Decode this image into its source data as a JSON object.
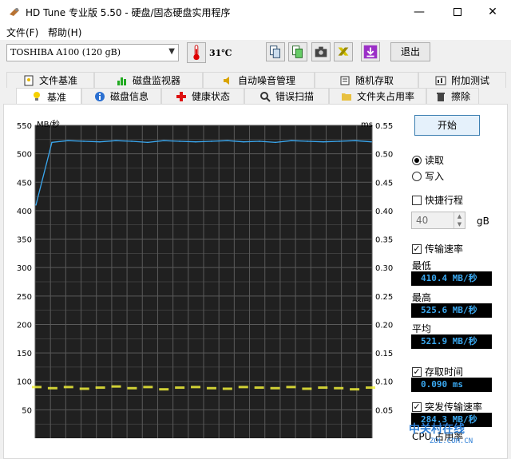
{
  "window": {
    "title": "HD Tune 专业版 5.50 - 硬盘/固态硬盘实用程序"
  },
  "menu": {
    "file": "文件(F)",
    "help": "帮助(H)"
  },
  "toolbar": {
    "drive": "TOSHIBA A100 (120 gB)",
    "temperature": "31℃",
    "exit_label": "退出",
    "icons": [
      "copy-info-icon",
      "copy-text-icon",
      "camera-icon",
      "settings-icon",
      "save-icon"
    ]
  },
  "tabs_top": [
    "文件基准",
    "磁盘监视器",
    "自动噪音管理",
    "随机存取",
    "附加测试"
  ],
  "tabs_bottom": [
    "基准",
    "磁盘信息",
    "健康状态",
    "错误扫描",
    "文件夹占用率",
    "擦除"
  ],
  "side": {
    "start_label": "开始",
    "read_label": "读取",
    "write_label": "写入",
    "quick_label": "快捷行程",
    "quick_value": "40",
    "quick_unit": "gB",
    "transfer_label": "传输速率",
    "min_label": "最低",
    "min_value": "410.4 MB/秒",
    "max_label": "最高",
    "max_value": "525.6 MB/秒",
    "avg_label": "平均",
    "avg_value": "521.9 MB/秒",
    "access_label": "存取时间",
    "access_value": "0.090 ms",
    "burst_label": "突发传输速率",
    "burst_value": "284.3 MB/秒",
    "cpu_label": "CPU 占用率"
  },
  "watermark": {
    "text": "中关村在线",
    "sub": "ZOL.COM.CN"
  },
  "chart_data": {
    "type": "line",
    "left_axis_label": "MB/秒",
    "right_axis_label": "ms",
    "y_ticks": [
      550,
      500,
      450,
      400,
      350,
      300,
      250,
      200,
      150,
      100,
      50
    ],
    "y2_ticks": [
      "0.55",
      "0.50",
      "0.45",
      "0.40",
      "0.35",
      "0.30",
      "0.25",
      "0.20",
      "0.15",
      "0.10",
      "0.05"
    ],
    "ylim": [
      0,
      550
    ],
    "y2lim": [
      0,
      0.55
    ],
    "grid": true,
    "colors": {
      "transfer": "#3aa8f0",
      "access": "#f0f03a",
      "bg": "#202020",
      "grid": "#5a5a5a"
    },
    "series": [
      {
        "values": [
          410,
          520,
          523,
          522,
          521,
          523,
          522,
          520,
          523,
          522,
          521,
          522,
          523,
          521,
          522,
          520,
          523,
          522,
          521,
          522,
          523,
          521
        ]
      },
      {
        "values": [
          0.09,
          0.088,
          0.09,
          0.087,
          0.089,
          0.091,
          0.088,
          0.09,
          0.086,
          0.089,
          0.09,
          0.088,
          0.087,
          0.09,
          0.089,
          0.088,
          0.09,
          0.087,
          0.089,
          0.088,
          0.086,
          0.089
        ]
      }
    ]
  }
}
